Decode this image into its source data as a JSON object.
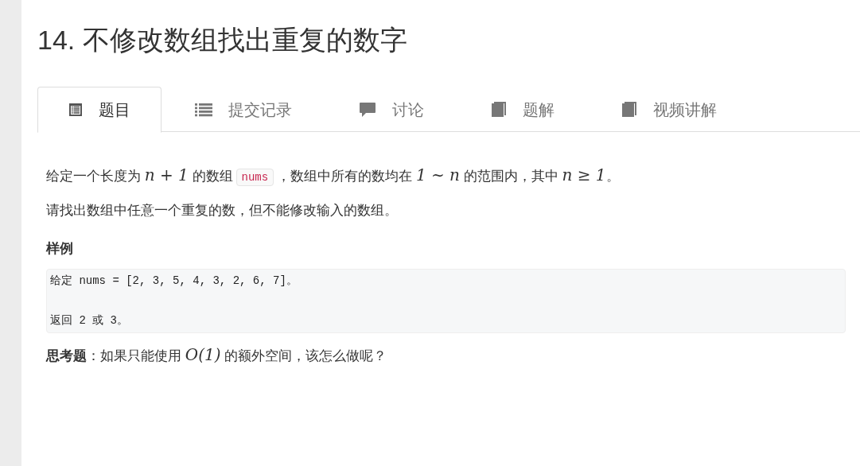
{
  "title": "14. 不修改数组找出重复的数字",
  "tabs": [
    {
      "label": "题目",
      "kind": "doc",
      "selected": true
    },
    {
      "label": "提交记录",
      "kind": "list",
      "selected": false
    },
    {
      "label": "讨论",
      "kind": "comment",
      "selected": false
    },
    {
      "label": "题解",
      "kind": "book",
      "selected": false
    },
    {
      "label": "视频讲解",
      "kind": "book",
      "selected": false
    }
  ],
  "content": [
    {
      "kind": "paragraph",
      "parts": [
        {
          "kind": "text",
          "text": "给定一个长度为 "
        },
        {
          "kind": "math",
          "text": "n + 1"
        },
        {
          "kind": "text",
          "text": " 的数组"
        },
        {
          "kind": "code",
          "text": "nums"
        },
        {
          "kind": "text",
          "text": "，数组中所有的数均在 "
        },
        {
          "kind": "math",
          "text": "1 ∼ n"
        },
        {
          "kind": "text",
          "text": " 的范围内，其中 "
        },
        {
          "kind": "math",
          "text": "n ≥ 1"
        },
        {
          "kind": "text",
          "text": "。"
        }
      ]
    },
    {
      "kind": "paragraph",
      "parts": [
        {
          "kind": "text",
          "text": "请找出数组中任意一个重复的数，但不能修改输入的数组。"
        }
      ]
    },
    {
      "kind": "heading",
      "text": "样例"
    },
    {
      "kind": "codeblock",
      "lines": [
        "给定 nums = [2, 3, 5, 4, 3, 2, 6, 7]。",
        "返回 2 或 3。"
      ]
    },
    {
      "kind": "paragraph",
      "parts": [
        {
          "kind": "bold",
          "text": "思考题"
        },
        {
          "kind": "text",
          "text": "：如果只能使用 "
        },
        {
          "kind": "math",
          "text": "O(1)"
        },
        {
          "kind": "text",
          "text": " 的额外空间，该怎么做呢？"
        }
      ]
    }
  ]
}
